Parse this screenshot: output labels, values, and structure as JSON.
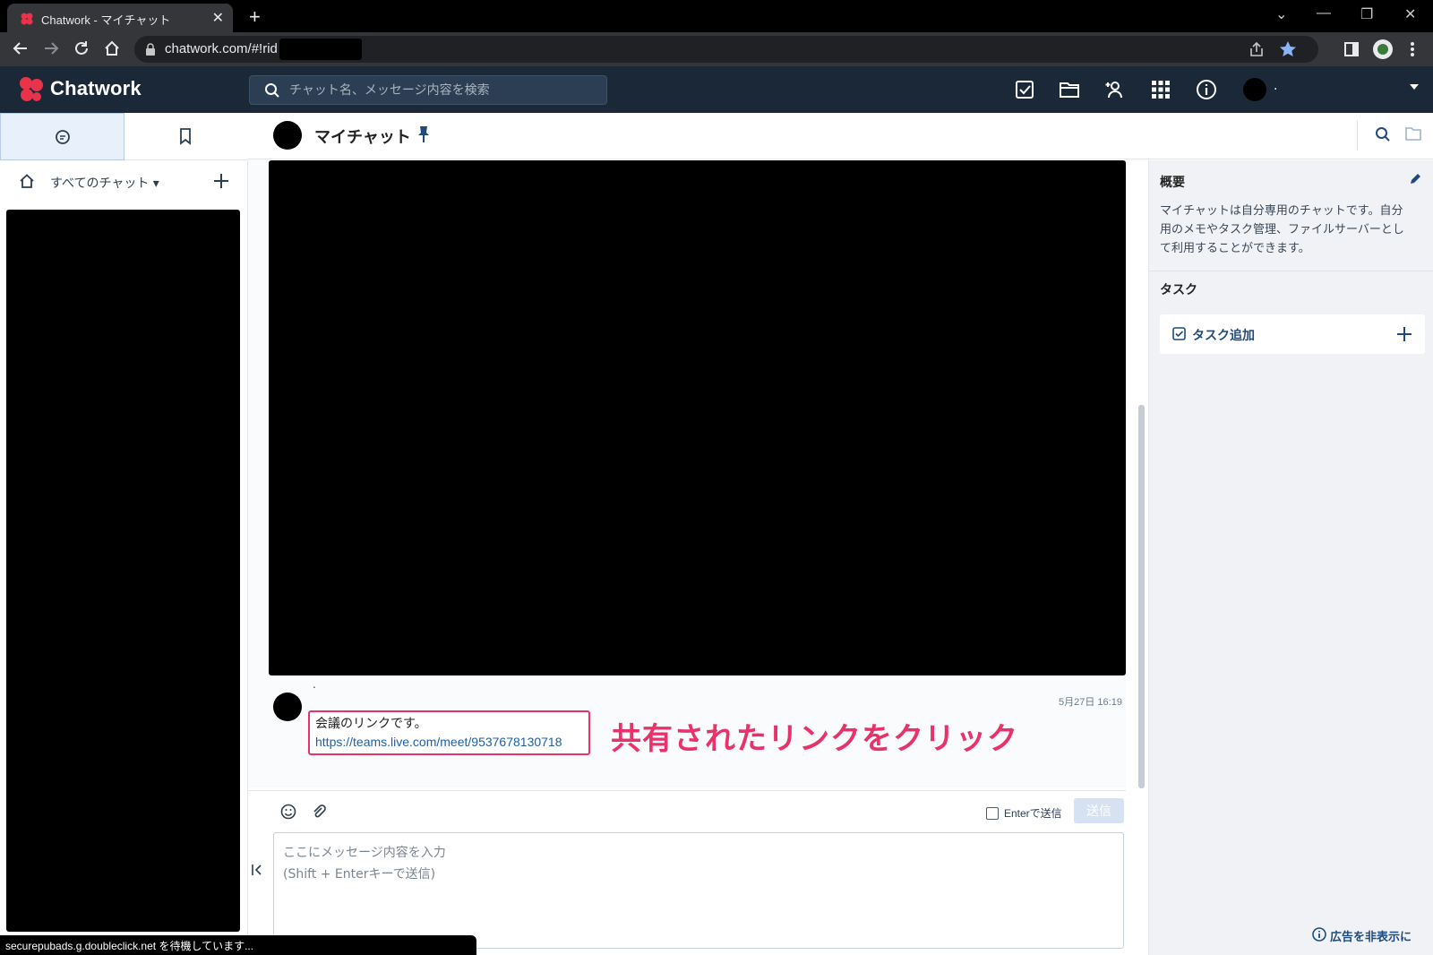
{
  "browser": {
    "tab_title": "Chatwork - マイチャット",
    "tab_close": "✕",
    "new_tab": "+",
    "url": "chatwork.com/#!rid",
    "window_controls": {
      "minimize": "—",
      "restore": "❐",
      "close": "✕",
      "tabsearch": "⌄"
    }
  },
  "app": {
    "logo_text": "Chatwork",
    "search_placeholder": "チャット名、メッセージ内容を検索",
    "header_username": ".",
    "brand_color": "#1b2838"
  },
  "left": {
    "all_chats_label": "すべてのチャット ▾"
  },
  "room": {
    "name": "マイチャット"
  },
  "message": {
    "sender": ".",
    "timestamp": "5月27日 16:19",
    "text": "会議のリンクです。",
    "link": "https://teams.live.com/meet/9537678130718"
  },
  "annotation": {
    "text": "共有されたリンクをクリック",
    "color": "#e8336a"
  },
  "composer": {
    "enter_send_label": "Enterで送信",
    "send_button": "送信",
    "placeholder": "ここにメッセージ内容を入力\n(Shift + Enterキーで送信)"
  },
  "right": {
    "overview_title": "概要",
    "overview_desc": "マイチャットは自分専用のチャットです。自分用のメモやタスク管理、ファイルサーバーとして利用することができます。",
    "task_title": "タスク",
    "task_add_label": "タスク追加",
    "hide_ad_label": "広告を非表示に"
  },
  "status_bar": "securepubads.g.doubleclick.net を待機しています..."
}
